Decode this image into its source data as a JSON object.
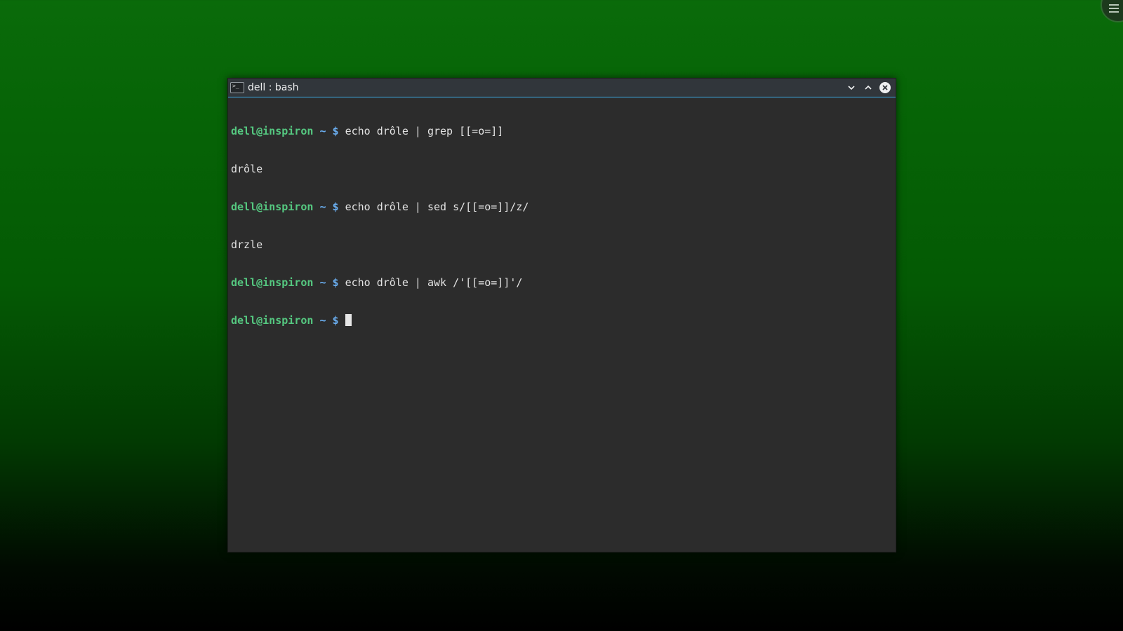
{
  "window": {
    "title": "dell : bash",
    "buttons": [
      "minimize",
      "maximize",
      "close"
    ]
  },
  "terminal": {
    "prompt_user": "dell@inspiron",
    "prompt_symbol": "~ $",
    "lines": [
      {
        "type": "command",
        "text": "echo drôle | grep [[=o=]]"
      },
      {
        "type": "output",
        "text": "drôle"
      },
      {
        "type": "command",
        "text": "echo drôle | sed s/[[=o=]]/z/"
      },
      {
        "type": "output",
        "text": "drzle"
      },
      {
        "type": "command",
        "text": "echo drôle | awk /'[[=o=]]'/"
      },
      {
        "type": "command",
        "text": ""
      }
    ]
  },
  "colors": {
    "prompt_user": "#55c880",
    "prompt_symbol": "#6aaef0",
    "terminal_bg": "#2c2c2c",
    "titlebar_bg": "#31363b",
    "accent": "#3daee9"
  },
  "icons": {
    "app": "terminal-icon",
    "desktop_menu": "hamburger-menu-icon"
  }
}
